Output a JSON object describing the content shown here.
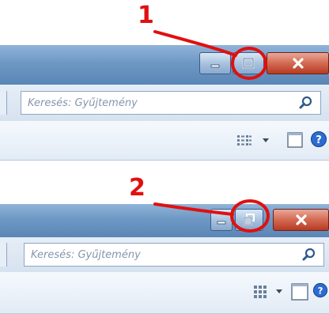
{
  "annotations": {
    "step1": "1",
    "step2": "2",
    "highlight_color": "#e01010"
  },
  "panel1": {
    "caption_buttons": [
      {
        "name": "minimize",
        "icon": "minimize-icon"
      },
      {
        "name": "maximize",
        "icon": "maximize-icon"
      },
      {
        "name": "close",
        "icon": "close-icon"
      }
    ],
    "search": {
      "placeholder": "Keresés: Gyűjtemény",
      "icon": "search-icon"
    },
    "toolbar": {
      "view_icon": "view-list-icon",
      "dropdown_icon": "chevron-down-icon",
      "preview_pane_icon": "preview-pane-icon",
      "help_icon": "help-icon"
    }
  },
  "panel2": {
    "caption_buttons": [
      {
        "name": "minimize",
        "icon": "minimize-icon"
      },
      {
        "name": "restore",
        "icon": "restore-icon"
      },
      {
        "name": "close",
        "icon": "close-icon"
      }
    ],
    "search": {
      "placeholder": "Keresés: Gyűjtemény",
      "icon": "search-icon"
    },
    "toolbar": {
      "view_icon": "view-tiles-icon",
      "dropdown_icon": "chevron-down-icon",
      "preview_pane_icon": "preview-pane-icon",
      "help_icon": "help-icon"
    }
  },
  "colors": {
    "titlebar": "#6e98c4",
    "close_button": "#d36a52",
    "help_blue": "#2c6bd1"
  }
}
